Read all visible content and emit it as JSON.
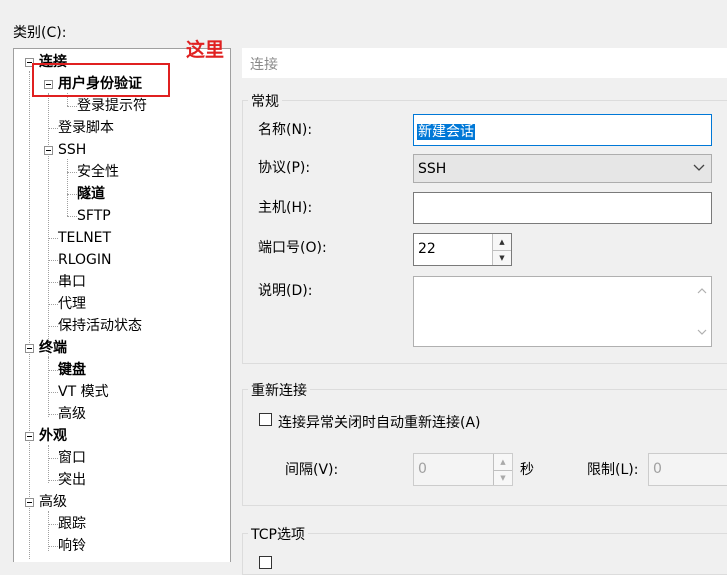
{
  "category_label": "类别(C):",
  "annotation": {
    "text": "这里",
    "color": "#e02020"
  },
  "tree": [
    {
      "label": "连接",
      "bold": true,
      "expander": true
    },
    {
      "label": "用户身份验证",
      "bold": true,
      "expander": true
    },
    {
      "label": "登录提示符"
    },
    {
      "label": "登录脚本"
    },
    {
      "label": "SSH",
      "expander": true
    },
    {
      "label": "安全性"
    },
    {
      "label": "隧道",
      "bold": true
    },
    {
      "label": "SFTP"
    },
    {
      "label": "TELNET"
    },
    {
      "label": "RLOGIN"
    },
    {
      "label": "串口"
    },
    {
      "label": "代理"
    },
    {
      "label": "保持活动状态"
    },
    {
      "label": "终端",
      "bold": true,
      "expander": true
    },
    {
      "label": "键盘",
      "bold": true
    },
    {
      "label": "VT 模式"
    },
    {
      "label": "高级"
    },
    {
      "label": "外观",
      "bold": true,
      "expander": true
    },
    {
      "label": "窗口"
    },
    {
      "label": "突出"
    },
    {
      "label": "高级",
      "expander": true
    },
    {
      "label": "跟踪"
    },
    {
      "label": "响铃"
    }
  ],
  "panel": {
    "title": "连接",
    "general": {
      "title": "常规",
      "name_label": "名称(N):",
      "name_value": "新建会话",
      "protocol_label": "协议(P):",
      "protocol_value": "SSH",
      "host_label": "主机(H):",
      "host_value": "",
      "port_label": "端口号(O):",
      "port_value": "22",
      "desc_label": "说明(D):",
      "desc_value": ""
    },
    "reconnect": {
      "title": "重新连接",
      "checkbox_label": "连接异常关闭时自动重新连接(A)",
      "interval_label": "间隔(V):",
      "interval_value": "0",
      "seconds_label": "秒",
      "limit_label": "限制(L):",
      "limit_value": "0"
    },
    "tcp": {
      "title": "TCP选项"
    }
  }
}
